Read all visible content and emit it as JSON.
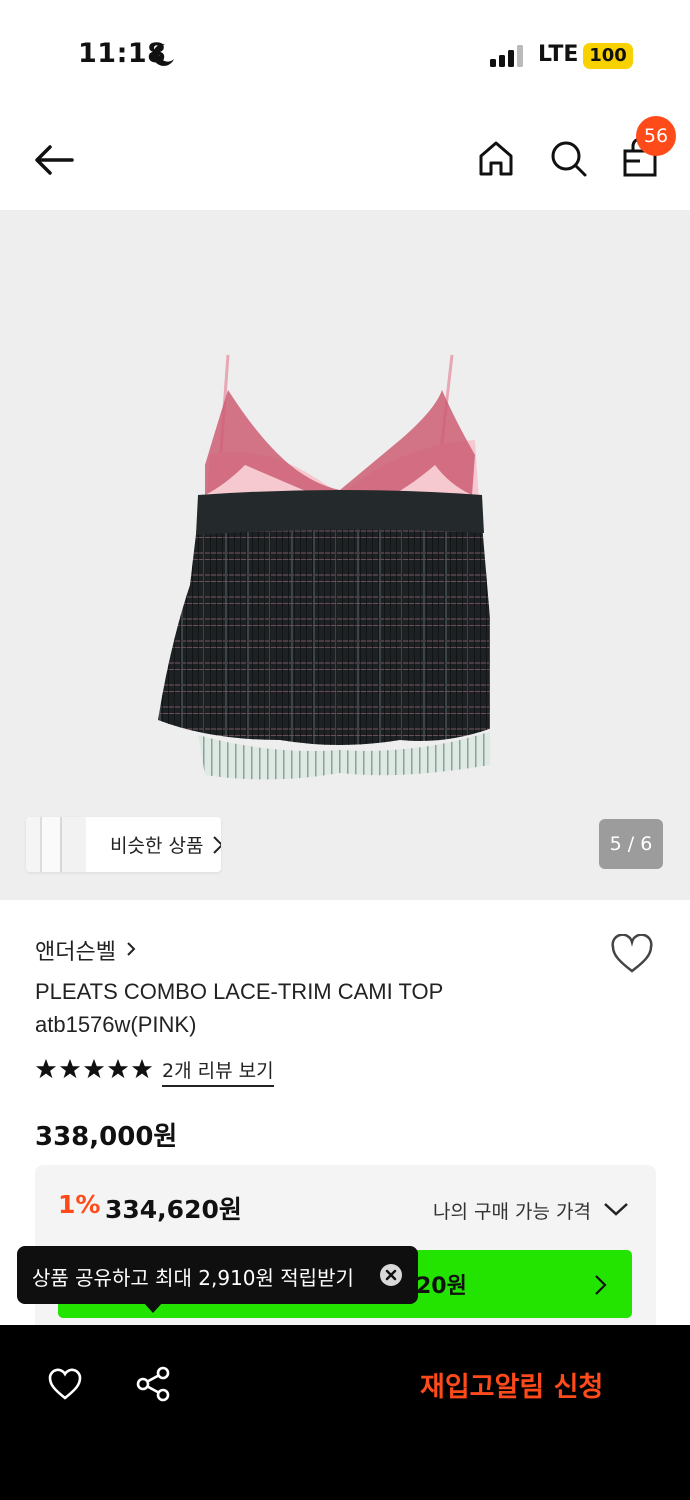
{
  "status_bar": {
    "time": "11:18",
    "network": "LTE",
    "battery": "100"
  },
  "header": {
    "cart_count": "56"
  },
  "gallery": {
    "similar_label": "비슷한 상품",
    "page_counter": "5 / 6"
  },
  "product": {
    "brand": "앤더슨벨",
    "title_line1": "PLEATS COMBO LACE-TRIM CAMI TOP",
    "title_line2": "atb1576w(PINK)",
    "rating": 5,
    "review_link": "2개 리뷰 보기",
    "price": "338,000원"
  },
  "price_box": {
    "discount_rate": "1%",
    "discount_price": "334,620원",
    "my_price_label": "나의 구매 가능 가격",
    "coupon_text": "20원"
  },
  "tooltip": {
    "text": "상품 공유하고 최대 2,910원 적립받기"
  },
  "bottom_bar": {
    "restock_label": "재입고알림 신청"
  },
  "colors": {
    "accent": "#ff4a1a",
    "coupon_green": "#22e400",
    "battery_yellow": "#f7d200"
  }
}
